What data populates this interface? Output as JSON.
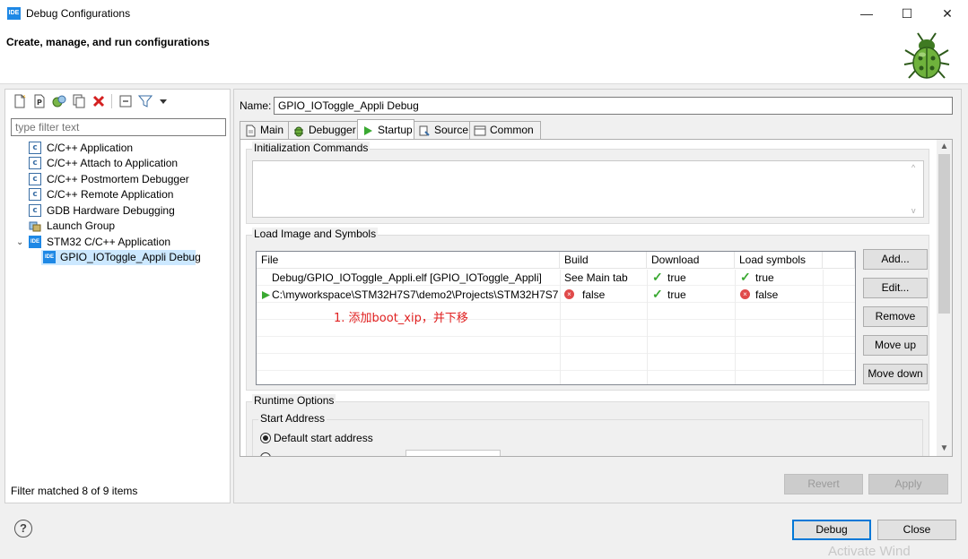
{
  "window": {
    "title": "Debug Configurations",
    "minimize": "—",
    "maximize": "☐",
    "close": "✕"
  },
  "header": {
    "title": "Create, manage, and run configurations"
  },
  "left": {
    "filter_placeholder": "type filter text",
    "tree": [
      {
        "label": "C/C++ Application",
        "icon": "c-launch-icon"
      },
      {
        "label": "C/C++ Attach to Application",
        "icon": "c-launch-icon"
      },
      {
        "label": "C/C++ Postmortem Debugger",
        "icon": "c-launch-icon"
      },
      {
        "label": "C/C++ Remote Application",
        "icon": "c-launch-icon"
      },
      {
        "label": "GDB Hardware Debugging",
        "icon": "c-launch-icon"
      },
      {
        "label": "Launch Group",
        "icon": "launch-group-icon"
      },
      {
        "label": "STM32 C/C++ Application",
        "icon": "ide-icon",
        "expanded": true
      },
      {
        "label": "GPIO_IOToggle_Appli Debug",
        "icon": "ide-icon",
        "selected": true
      }
    ],
    "status": "Filter matched 8 of 9 items"
  },
  "right": {
    "name_label": "Name:",
    "name_value": "GPIO_IOToggle_Appli Debug",
    "tabs": [
      {
        "label": "Main",
        "icon": "main-tab-icon"
      },
      {
        "label": "Debugger",
        "icon": "debugger-tab-icon"
      },
      {
        "label": "Startup",
        "icon": "startup-tab-icon",
        "active": true
      },
      {
        "label": "Source",
        "icon": "source-tab-icon"
      },
      {
        "label": "Common",
        "icon": "common-tab-icon"
      }
    ],
    "init_commands_title": "Initialization Commands",
    "load_image_title": "Load Image and Symbols",
    "table": {
      "headers": [
        "File",
        "Build",
        "Download",
        "Load symbols"
      ],
      "rows": [
        {
          "file": "Debug/GPIO_IOToggle_Appli.elf [GPIO_IOToggle_Appli]",
          "build": "See Main tab",
          "download": "true",
          "symbols": "true"
        },
        {
          "file": "C:\\myworkspace\\STM32H7S7\\demo2\\Projects\\STM32H7S7...",
          "build": "false",
          "download": "true",
          "symbols": "false"
        }
      ]
    },
    "annotation": "1. 添加boot_xip，并下移",
    "side_buttons": [
      "Add...",
      "Edit...",
      "Remove",
      "Move up",
      "Move down"
    ],
    "runtime_title": "Runtime Options",
    "start_address_title": "Start Address",
    "default_start": "Default start address",
    "revert": "Revert",
    "apply": "Apply"
  },
  "footer": {
    "debug": "Debug",
    "close": "Close",
    "help": "?",
    "watermark": "Activate Wind"
  }
}
